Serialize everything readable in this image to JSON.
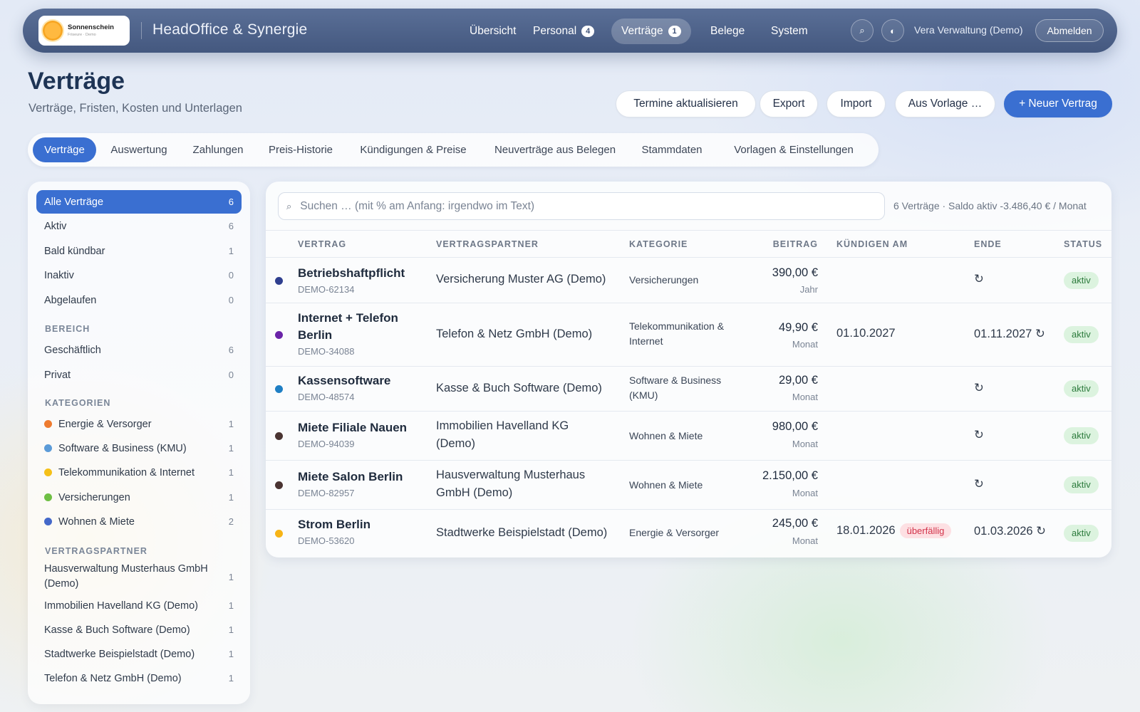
{
  "header": {
    "logo_name": "Sonnenschein",
    "logo_sub": "Friseure · Demo",
    "app_title": "HeadOffice & Synergie",
    "nav": [
      {
        "label": "Übersicht",
        "badge": ""
      },
      {
        "label": "Personal",
        "badge": "4"
      },
      {
        "label": "Verträge",
        "badge": "1"
      },
      {
        "label": "Belege",
        "badge": ""
      },
      {
        "label": "System",
        "badge": ""
      }
    ],
    "search_icon": "⌕",
    "theme_icon": "◐",
    "user": "Vera Verwaltung (Demo)",
    "logout": "Abmelden"
  },
  "page": {
    "title": "Verträge",
    "subtitle": "Verträge, Fristen, Kosten und Unterlagen"
  },
  "actions": {
    "refresh": "Termine aktualisieren",
    "export": "Export",
    "import": "Import",
    "template": "Aus Vorlage …",
    "new": "+ Neuer Vertrag"
  },
  "tabs": [
    "Verträge",
    "Auswertung",
    "Zahlungen",
    "Preis-Historie",
    "Kündigungen & Preise",
    "Neuverträge aus Belegen",
    "Stammdaten",
    "Vorlagen & Einstellungen"
  ],
  "sidebar": {
    "status": [
      {
        "label": "Alle Verträge",
        "count": "6"
      },
      {
        "label": "Aktiv",
        "count": "6"
      },
      {
        "label": "Bald kündbar",
        "count": "1"
      },
      {
        "label": "Inaktiv",
        "count": "0"
      },
      {
        "label": "Abgelaufen",
        "count": "0"
      }
    ],
    "bereich_heading": "BEREICH",
    "bereich": [
      {
        "label": "Geschäftlich",
        "count": "6"
      },
      {
        "label": "Privat",
        "count": "0"
      }
    ],
    "kategorien_heading": "KATEGORIEN",
    "kategorien": [
      {
        "label": "Energie & Versorger",
        "count": "1",
        "color": "#ee7b2f"
      },
      {
        "label": "Software & Business (KMU)",
        "count": "1",
        "color": "#5b9bd8"
      },
      {
        "label": "Telekommunikation & Internet",
        "count": "1",
        "color": "#f5c018"
      },
      {
        "label": "Versicherungen",
        "count": "1",
        "color": "#6fbf44"
      },
      {
        "label": "Wohnen & Miete",
        "count": "2",
        "color": "#4468c9"
      }
    ],
    "partner_heading": "VERTRAGSPARTNER",
    "partner": [
      {
        "label": "Hausverwaltung Musterhaus GmbH (Demo)",
        "count": "1"
      },
      {
        "label": "Immobilien Havelland KG (Demo)",
        "count": "1"
      },
      {
        "label": "Kasse & Buch Software (Demo)",
        "count": "1"
      },
      {
        "label": "Stadtwerke Beispielstadt (Demo)",
        "count": "1"
      },
      {
        "label": "Telefon & Netz GmbH (Demo)",
        "count": "1"
      }
    ]
  },
  "table": {
    "search_placeholder": "Suchen … (mit % am Anfang: irgendwo im Text)",
    "summary": "6 Verträge · Saldo aktiv -3.486,40 € / Monat",
    "columns": [
      "VERTRAG",
      "VERTRAGSPARTNER",
      "KATEGORIE",
      "BEITRAG",
      "KÜNDIGEN AM",
      "ENDE",
      "STATUS"
    ],
    "rows": [
      {
        "name": "Betriebshaftpflicht",
        "id": "DEMO-62134",
        "partner": "Versicherung Muster AG (Demo)",
        "category": "Versicherungen",
        "amount": "390,00 €",
        "period": "Jahr",
        "kuendigen": "",
        "overdue": "",
        "ende": "↻",
        "status": "aktiv",
        "color": "#2f3f8f"
      },
      {
        "name": "Internet + Telefon Berlin",
        "id": "DEMO-34088",
        "partner": "Telefon & Netz GmbH (Demo)",
        "category": "Telekommunikation & Internet",
        "amount": "49,90 €",
        "period": "Monat",
        "kuendigen": "01.10.2027",
        "overdue": "",
        "ende": "01.11.2027 ↻",
        "status": "aktiv",
        "color": "#6a24a8"
      },
      {
        "name": "Kassensoftware",
        "id": "DEMO-48574",
        "partner": "Kasse & Buch Software (Demo)",
        "category": "Software & Business (KMU)",
        "amount": "29,00 €",
        "period": "Monat",
        "kuendigen": "",
        "overdue": "",
        "ende": "↻",
        "status": "aktiv",
        "color": "#1f7fc4"
      },
      {
        "name": "Miete Filiale Nauen",
        "id": "DEMO-94039",
        "partner": "Immobilien Havelland KG (Demo)",
        "category": "Wohnen & Miete",
        "amount": "980,00 €",
        "period": "Monat",
        "kuendigen": "",
        "overdue": "",
        "ende": "↻",
        "status": "aktiv",
        "color": "#4a3432"
      },
      {
        "name": "Miete Salon Berlin",
        "id": "DEMO-82957",
        "partner": "Hausverwaltung Musterhaus GmbH (Demo)",
        "category": "Wohnen & Miete",
        "amount": "2.150,00 €",
        "period": "Monat",
        "kuendigen": "",
        "overdue": "",
        "ende": "↻",
        "status": "aktiv",
        "color": "#4a3432"
      },
      {
        "name": "Strom Berlin",
        "id": "DEMO-53620",
        "partner": "Stadtwerke Beispielstadt (Demo)",
        "category": "Energie & Versorger",
        "amount": "245,00 €",
        "period": "Monat",
        "kuendigen": "18.01.2026",
        "overdue": "überfällig",
        "ende": "01.03.2026 ↻",
        "status": "aktiv",
        "color": "#f7b416"
      }
    ]
  }
}
